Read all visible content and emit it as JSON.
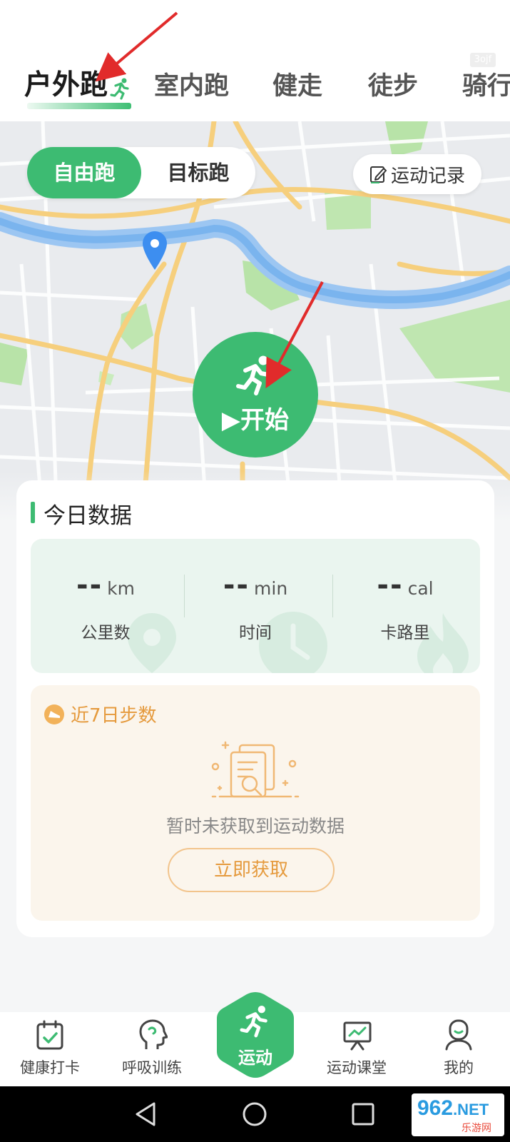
{
  "tabs": [
    {
      "label": "户外跑",
      "active": true
    },
    {
      "label": "室内跑"
    },
    {
      "label": "健走"
    },
    {
      "label": "徒步"
    },
    {
      "label": "骑行"
    }
  ],
  "corner_mark": "3ojf",
  "map": {
    "mode_toggle": {
      "selected": "自由跑",
      "other": "目标跑"
    },
    "record_button": "运动记录",
    "start_button": "▶开始",
    "accent": "#3dbb72"
  },
  "today": {
    "title": "今日数据",
    "stats": [
      {
        "value": "--",
        "unit": "km",
        "label": "公里数",
        "icon": "location-pin-icon"
      },
      {
        "value": "--",
        "unit": "min",
        "label": "时间",
        "icon": "clock-icon"
      },
      {
        "value": "--",
        "unit": "cal",
        "label": "卡路里",
        "icon": "flame-icon"
      }
    ]
  },
  "steps": {
    "title": "近7日步数",
    "empty_text": "暂时未获取到运动数据",
    "fetch_button": "立即获取",
    "accent": "#e59a3d"
  },
  "bottom_nav": [
    {
      "label": "健康打卡",
      "icon": "calendar-check-icon"
    },
    {
      "label": "呼吸训练",
      "icon": "head-breath-icon"
    },
    {
      "label": "运动",
      "icon": "runner-icon",
      "active": true
    },
    {
      "label": "运动课堂",
      "icon": "presentation-icon"
    },
    {
      "label": "我的",
      "icon": "profile-icon"
    }
  ],
  "watermark": {
    "main_a": "962",
    "main_b": ".NET",
    "sub": "乐游网"
  }
}
